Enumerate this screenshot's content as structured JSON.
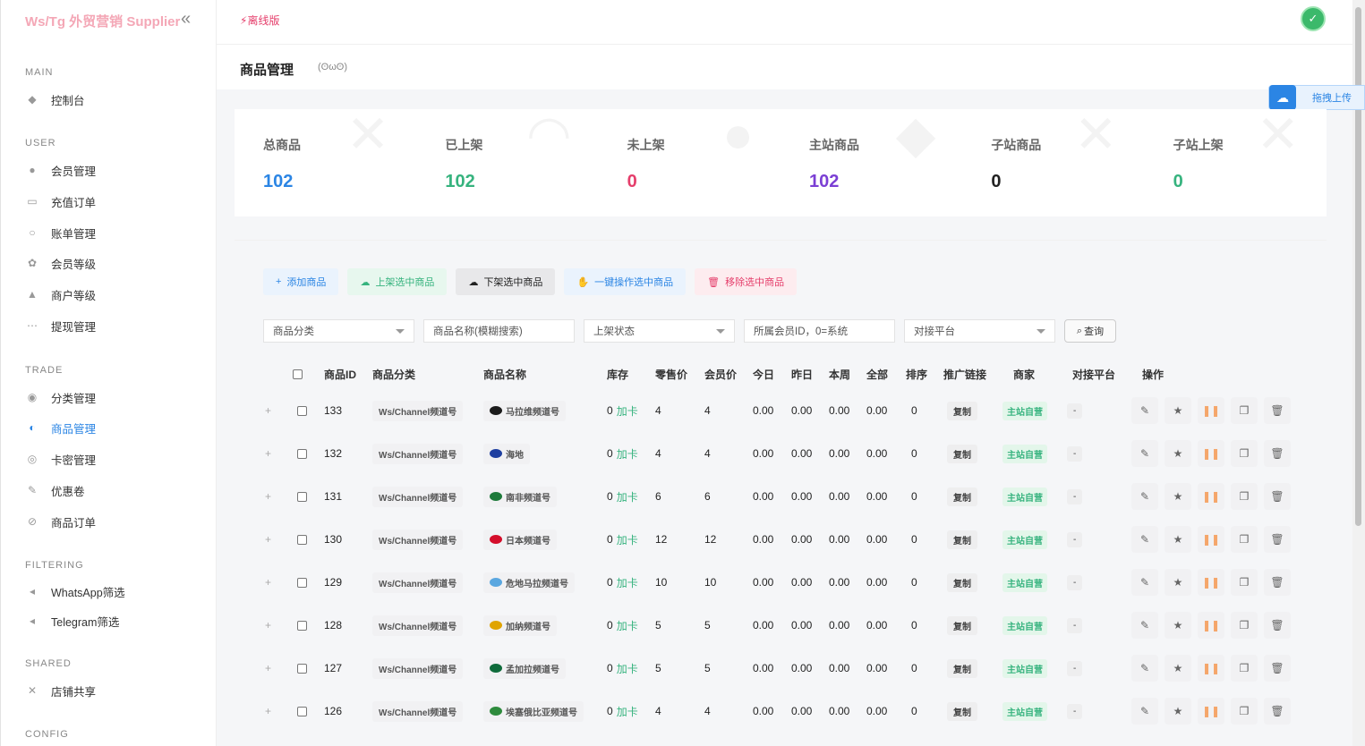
{
  "brand": {
    "title": "Ws/Tg 外贸营销 Supplier"
  },
  "sidebar": {
    "sections": [
      {
        "label": "MAIN",
        "items": [
          {
            "label": "控制台",
            "icon": "dashboard-icon"
          }
        ]
      },
      {
        "label": "USER",
        "items": [
          {
            "label": "会员管理",
            "icon": "user-icon"
          },
          {
            "label": "充值订单",
            "icon": "recharge-icon"
          },
          {
            "label": "账单管理",
            "icon": "bill-icon"
          },
          {
            "label": "会员等级",
            "icon": "level-icon"
          },
          {
            "label": "商户等级",
            "icon": "merchant-level-icon"
          },
          {
            "label": "提现管理",
            "icon": "withdraw-icon"
          }
        ]
      },
      {
        "label": "TRADE",
        "items": [
          {
            "label": "分类管理",
            "icon": "category-icon"
          },
          {
            "label": "商品管理",
            "icon": "goods-icon",
            "active": true
          },
          {
            "label": "卡密管理",
            "icon": "card-icon"
          },
          {
            "label": "优惠卷",
            "icon": "coupon-icon"
          },
          {
            "label": "商品订单",
            "icon": "order-icon"
          }
        ]
      },
      {
        "label": "FILTERING",
        "items": [
          {
            "label": "WhatsApp筛选",
            "icon": "whatsapp-icon"
          },
          {
            "label": "Telegram筛选",
            "icon": "telegram-icon"
          }
        ]
      },
      {
        "label": "SHARED",
        "items": [
          {
            "label": "店铺共享",
            "icon": "share-icon"
          }
        ]
      },
      {
        "label": "CONFIG",
        "items": []
      }
    ]
  },
  "header": {
    "offline_label": "离线版",
    "upload_label": "拖拽上传"
  },
  "page": {
    "title": "商品管理",
    "kaomoji": "(ʘωʘ)"
  },
  "stats": [
    {
      "label": "总商品",
      "value": "102",
      "color": "#2b85e4"
    },
    {
      "label": "已上架",
      "value": "102",
      "color": "#36b37e"
    },
    {
      "label": "未上架",
      "value": "0",
      "color": "#e53e6b"
    },
    {
      "label": "主站商品",
      "value": "102",
      "color": "#7b3fd4"
    },
    {
      "label": "子站商品",
      "value": "0",
      "color": "#222222"
    },
    {
      "label": "子站上架",
      "value": "0",
      "color": "#36b37e"
    }
  ],
  "toolbar": {
    "add": "添加商品",
    "list_on": "上架选中商品",
    "list_off": "下架选中商品",
    "one_key": "一键操作选中商品",
    "remove": "移除选中商品"
  },
  "filters": {
    "category": "商品分类",
    "name_placeholder": "商品名称(模糊搜索)",
    "status": "上架状态",
    "member_placeholder": "所属会员ID，0=系统",
    "platform": "对接平台",
    "query": "查询"
  },
  "table": {
    "headers": [
      "商品ID",
      "商品分类",
      "商品名称",
      "库存",
      "零售价",
      "会员价",
      "今日",
      "昨日",
      "本周",
      "全部",
      "排序",
      "推广链接",
      "商家",
      "对接平台",
      "操作"
    ],
    "stock_unit": "加卡",
    "copy_label": "复制",
    "merchant_label": "主站自营",
    "platform_label": "-",
    "rows": [
      {
        "id": "133",
        "category": "Ws/Channel频道号",
        "name": "马拉维频道号",
        "flag": "#1b1b1b",
        "stock": "0",
        "retail": "4",
        "member": "4",
        "today": "0.00",
        "yesterday": "0.00",
        "week": "0.00",
        "all": "0.00",
        "sort": "0"
      },
      {
        "id": "132",
        "category": "Ws/Channel频道号",
        "name": "海地",
        "flag": "#1e3fa0",
        "stock": "0",
        "retail": "4",
        "member": "4",
        "today": "0.00",
        "yesterday": "0.00",
        "week": "0.00",
        "all": "0.00",
        "sort": "0"
      },
      {
        "id": "131",
        "category": "Ws/Channel频道号",
        "name": "南非频道号",
        "flag": "#1d7a3a",
        "stock": "0",
        "retail": "6",
        "member": "6",
        "today": "0.00",
        "yesterday": "0.00",
        "week": "0.00",
        "all": "0.00",
        "sort": "0"
      },
      {
        "id": "130",
        "category": "Ws/Channel频道号",
        "name": "日本频道号",
        "flag": "#d40d2a",
        "stock": "0",
        "retail": "12",
        "member": "12",
        "today": "0.00",
        "yesterday": "0.00",
        "week": "0.00",
        "all": "0.00",
        "sort": "0"
      },
      {
        "id": "129",
        "category": "Ws/Channel频道号",
        "name": "危地马拉频道号",
        "flag": "#5aa7e0",
        "stock": "0",
        "retail": "10",
        "member": "10",
        "today": "0.00",
        "yesterday": "0.00",
        "week": "0.00",
        "all": "0.00",
        "sort": "0"
      },
      {
        "id": "128",
        "category": "Ws/Channel频道号",
        "name": "加纳频道号",
        "flag": "#e0a400",
        "stock": "0",
        "retail": "5",
        "member": "5",
        "today": "0.00",
        "yesterday": "0.00",
        "week": "0.00",
        "all": "0.00",
        "sort": "0"
      },
      {
        "id": "127",
        "category": "Ws/Channel频道号",
        "name": "孟加拉频道号",
        "flag": "#0f6b3b",
        "stock": "0",
        "retail": "5",
        "member": "5",
        "today": "0.00",
        "yesterday": "0.00",
        "week": "0.00",
        "all": "0.00",
        "sort": "0"
      },
      {
        "id": "126",
        "category": "Ws/Channel频道号",
        "name": "埃塞俄比亚频道号",
        "flag": "#2e8b3d",
        "stock": "0",
        "retail": "4",
        "member": "4",
        "today": "0.00",
        "yesterday": "0.00",
        "week": "0.00",
        "all": "0.00",
        "sort": "0"
      }
    ]
  }
}
